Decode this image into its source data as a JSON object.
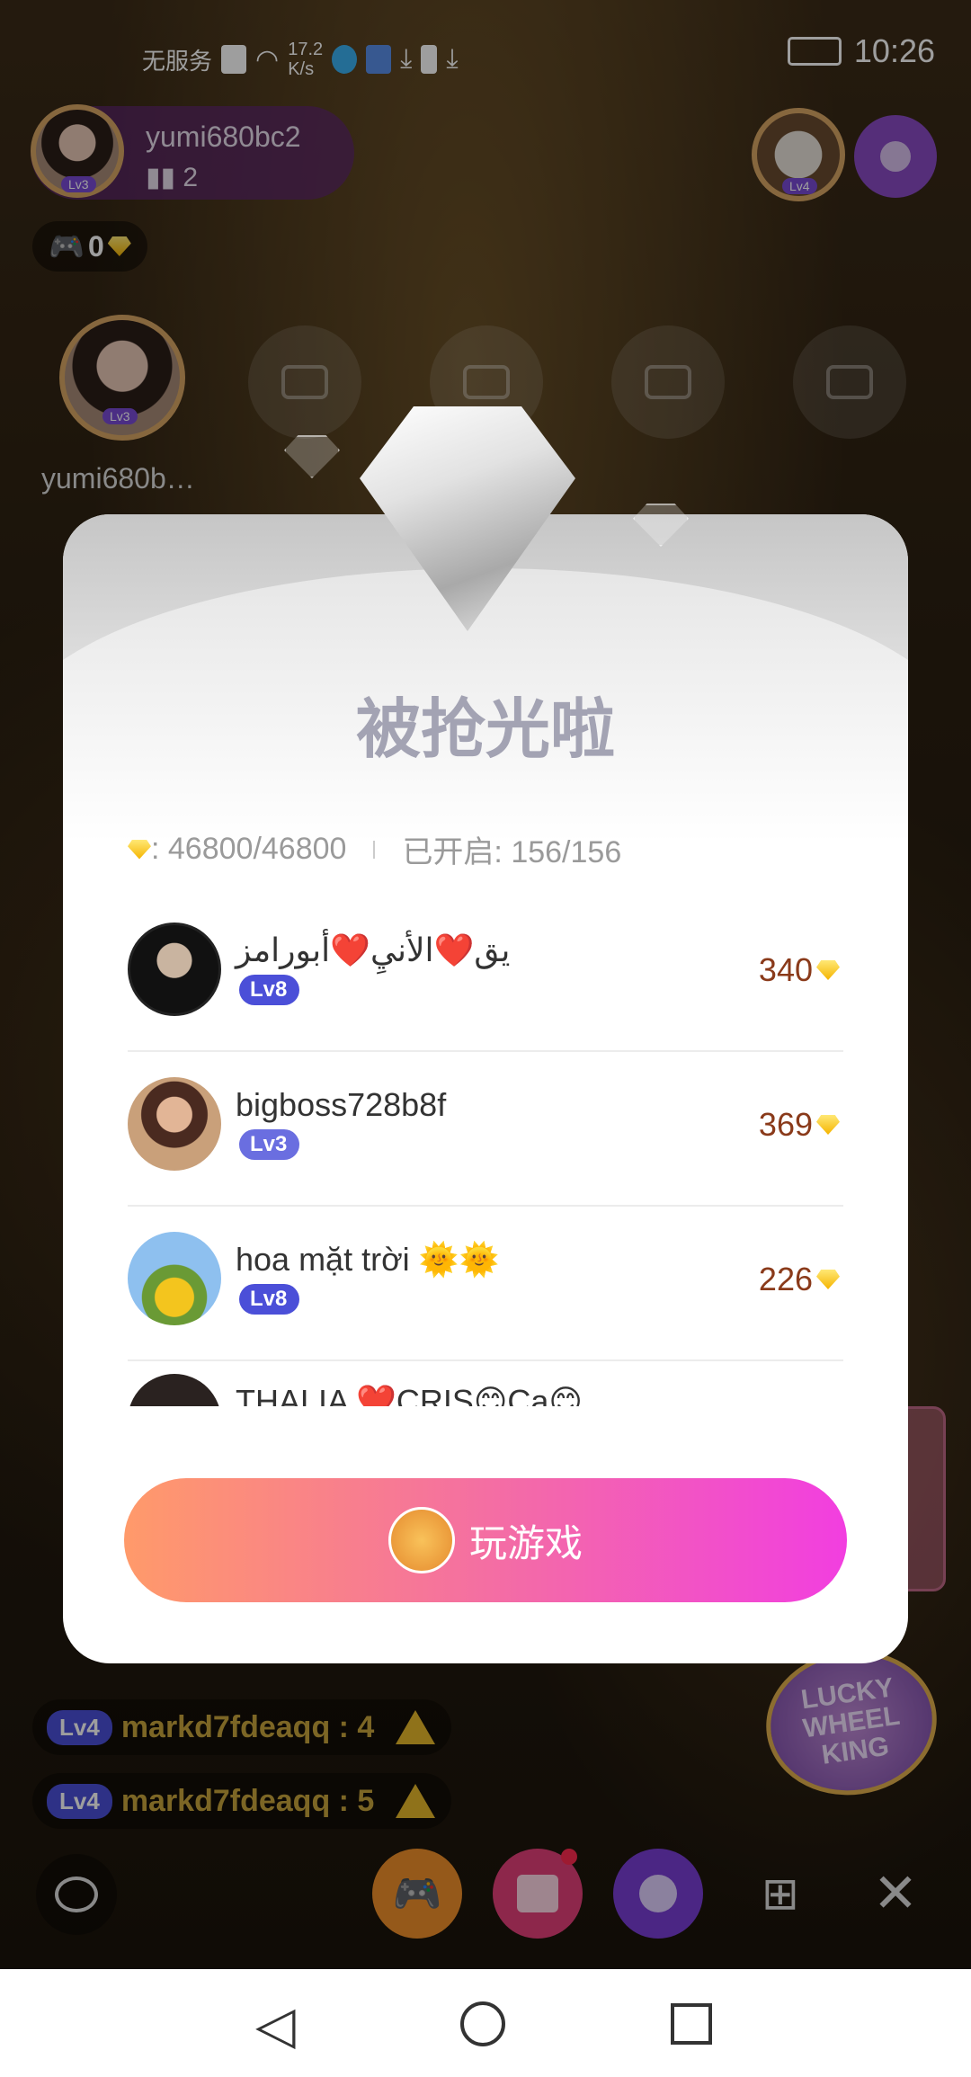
{
  "status_bar": {
    "carrier": "无服务",
    "speed": "17.2\nK/s",
    "time": "10:26"
  },
  "host": {
    "name": "yumi680bc2",
    "listeners": "2",
    "level": "Lv3"
  },
  "gem_pill": {
    "value": "0"
  },
  "right_user": {
    "level": "Lv4"
  },
  "seat_owner": {
    "name": "yumi680b…",
    "level": "Lv3"
  },
  "chat": [
    {
      "level": "Lv4",
      "text": "markd7fdeaqq : 4"
    },
    {
      "level": "Lv4",
      "text": "markd7fdeaqq : 5"
    }
  ],
  "lucky": {
    "line1": "LUCKY",
    "line2": "WHEEL",
    "line3": "KING"
  },
  "modal": {
    "title": "被抢光啦",
    "diamonds_stat": ": 46800/46800",
    "opened_stat": "已开启: 156/156",
    "rows": [
      {
        "name": "يق❤️الأنيِ❤️أبورامز",
        "level": "Lv8",
        "amount": "340"
      },
      {
        "name": "bigboss728b8f",
        "level": "Lv3",
        "amount": "369"
      },
      {
        "name": "hoa mặt trời 🌞🌞",
        "level": "Lv8",
        "amount": "226"
      },
      {
        "name": "THALIA ❤️CRIS😊Ca😊",
        "level": "",
        "amount": ""
      }
    ],
    "play_button": "玩游戏"
  },
  "colors": {
    "accent_gradient_start": "#ff9a6a",
    "accent_gradient_end": "#f23ee0",
    "level_badge": "#4b4fd8"
  }
}
